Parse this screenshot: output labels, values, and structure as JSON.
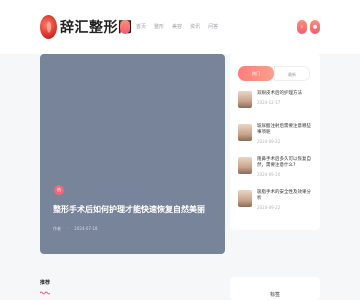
{
  "header": {
    "logo_text": "辞汇整形网",
    "nav": [
      "首页",
      "整形",
      "美容",
      "资讯",
      "问答"
    ],
    "right_buttons": [
      "search-icon",
      "user-icon"
    ],
    "accent": "#f25c6e"
  },
  "hero": {
    "badge": "热",
    "title": "整形手术后如何护理才能快速恢复自然美丽",
    "author": "作者",
    "date": "2024-07-18",
    "bg": "#78849a"
  },
  "sidebar": {
    "tabs": [
      "热门",
      "最新"
    ],
    "items": [
      {
        "title": "双眼皮术后的护理方法",
        "date": "2024-12-17"
      },
      {
        "title": "玻尿酸注射后需要注意哪些事项呢",
        "date": "2024-09-22"
      },
      {
        "title": "隆鼻手术后多久可以恢复自然，需要注意什么?",
        "date": "2024-09-20"
      },
      {
        "title": "吸脂手术的安全性及效果分析",
        "date": "2024-09-22"
      }
    ]
  },
  "bottom": {
    "section_title": "推荐",
    "card_label": "标签"
  }
}
